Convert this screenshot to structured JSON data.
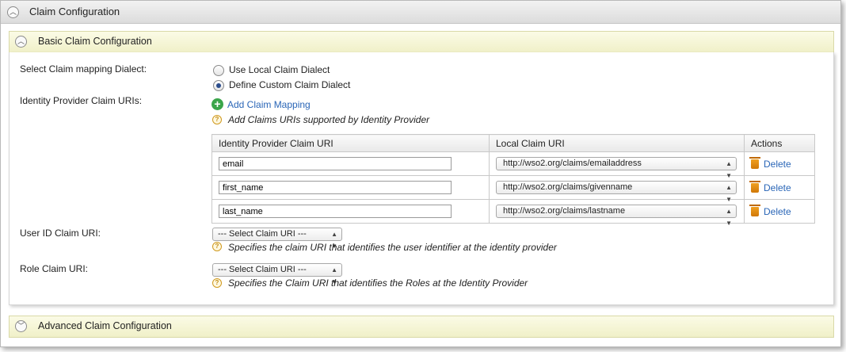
{
  "claim_config": {
    "title": "Claim Configuration"
  },
  "basic": {
    "title": "Basic Claim Configuration",
    "dialect_label": "Select Claim mapping Dialect:",
    "radio_local": "Use Local Claim Dialect",
    "radio_custom": "Define Custom Claim Dialect",
    "selected": "custom",
    "idp_claims_label": "Identity Provider Claim URIs:",
    "add_mapping": "Add Claim Mapping",
    "add_help": "Add Claims URIs supported by Identity Provider",
    "table": {
      "headers": [
        "Identity Provider Claim URI",
        "Local Claim URI",
        "Actions"
      ],
      "rows": [
        {
          "idp": "email",
          "local": "http://wso2.org/claims/emailaddress",
          "action": "Delete"
        },
        {
          "idp": "first_name",
          "local": "http://wso2.org/claims/givenname",
          "action": "Delete"
        },
        {
          "idp": "last_name",
          "local": "http://wso2.org/claims/lastname",
          "action": "Delete"
        }
      ]
    },
    "user_id_label": "User ID Claim URI:",
    "user_id_select": "--- Select Claim URI ---",
    "user_id_help": "Specifies the claim URI that identifies the user identifier at the identity provider",
    "role_label": "Role Claim URI:",
    "role_select": "--- Select Claim URI ---",
    "role_help": "Specifies the Claim URI that identifies the Roles at the Identity Provider"
  },
  "advanced": {
    "title": "Advanced Claim Configuration"
  },
  "colors": {
    "link": "#2a66b7",
    "subheader_bg": "#f0f0c8",
    "add_icon": "#3aa54a",
    "trash_icon": "#e08a10"
  }
}
